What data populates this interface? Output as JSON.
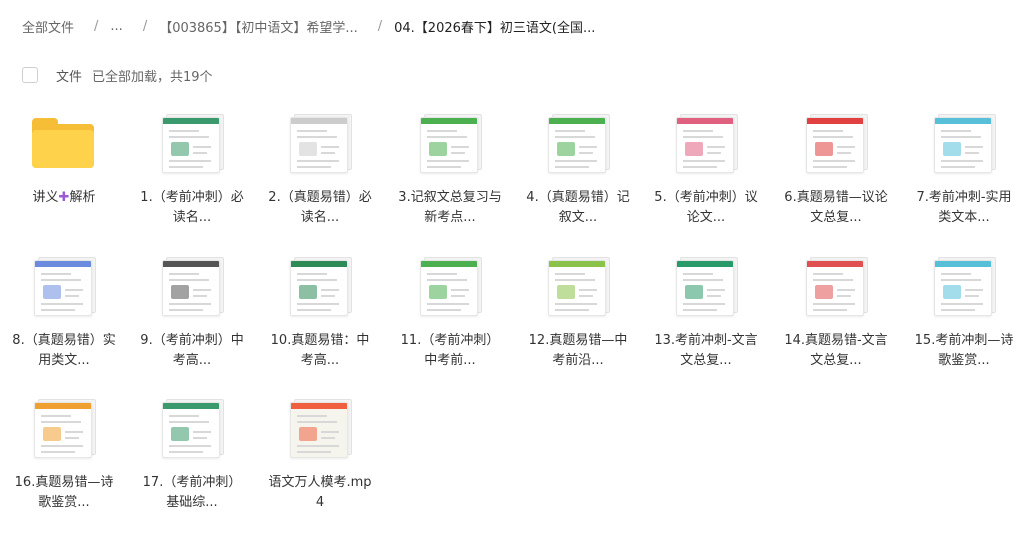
{
  "breadcrumb": {
    "items": [
      "全部文件",
      "...",
      "【003865】【初中语文】希望学...",
      "04.【2026春下】初三语文(全国..."
    ],
    "separator": "/"
  },
  "toolbar": {
    "files_label": "文件",
    "status": "已全部加载，共19个"
  },
  "files": [
    {
      "type": "folder",
      "name_parts": [
        "讲义",
        "✚",
        "解析"
      ],
      "icon": "folder-icon"
    },
    {
      "type": "doc",
      "name": "1.（考前冲刺）必读名...",
      "accent": "#3a9a6e"
    },
    {
      "type": "doc",
      "name": "2.（真题易错）必读名...",
      "accent": "#cccccc"
    },
    {
      "type": "doc",
      "name": "3.记叙文总复习与新考点...",
      "accent": "#4caf50"
    },
    {
      "type": "doc",
      "name": "4.（真题易错）记叙文...",
      "accent": "#4caf50"
    },
    {
      "type": "doc",
      "name": "5.（考前冲刺）议论文...",
      "accent": "#e06080"
    },
    {
      "type": "doc",
      "name": "6.真题易错—议论文总复...",
      "accent": "#e04040"
    },
    {
      "type": "doc",
      "name": "7.考前冲刺-实用类文本...",
      "accent": "#57c0d8"
    },
    {
      "type": "doc",
      "name": "8.（真题易错）实用类文...",
      "accent": "#6b8cde"
    },
    {
      "type": "doc",
      "name": "9.（考前冲刺）中考高...",
      "accent": "#555555"
    },
    {
      "type": "doc",
      "name": "10.真题易错：中考高...",
      "accent": "#2e8b57"
    },
    {
      "type": "doc",
      "name": "11.（考前冲刺）中考前...",
      "accent": "#4caf50"
    },
    {
      "type": "doc",
      "name": "12.真题易错—中考前沿...",
      "accent": "#8bc34a"
    },
    {
      "type": "doc",
      "name": "13.考前冲刺-文言文总复...",
      "accent": "#2b9a6a"
    },
    {
      "type": "doc",
      "name": "14.真题易错-文言文总复...",
      "accent": "#e05050"
    },
    {
      "type": "doc",
      "name": "15.考前冲刺—诗歌鉴赏...",
      "accent": "#57c0d8"
    },
    {
      "type": "doc",
      "name": "16.真题易错—诗歌鉴赏...",
      "accent": "#f0a030"
    },
    {
      "type": "doc",
      "name": "17.（考前冲刺）基础综...",
      "accent": "#3a9a6e"
    },
    {
      "type": "video",
      "name": "语文万人模考.mp4",
      "accent": "#f06040"
    }
  ]
}
